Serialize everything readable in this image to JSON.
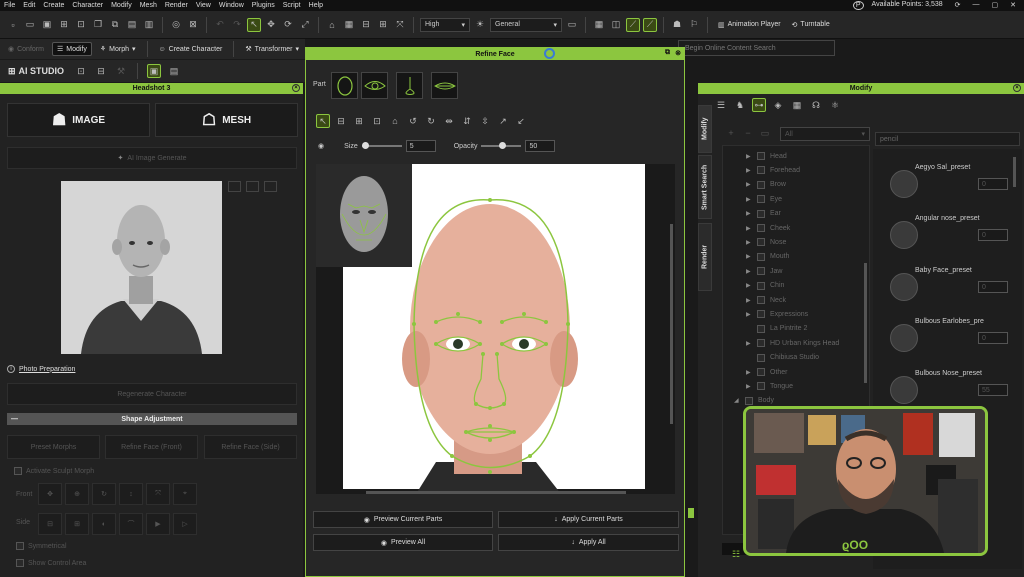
{
  "menu": [
    "File",
    "Edit",
    "Create",
    "Character",
    "Modify",
    "Mesh",
    "Render",
    "View",
    "Window",
    "Plugins",
    "Script",
    "Help"
  ],
  "account": {
    "points": "Available Points: 3,538"
  },
  "toolbar": {
    "quality": "High",
    "mode": "General",
    "animation_player": "Animation Player",
    "turntable": "Turntable"
  },
  "toolbar2": {
    "conform": "Conform",
    "modify": "Modify",
    "morph": "Morph",
    "create_character": "Create Character",
    "transformer": "Transformer"
  },
  "ai_studio": {
    "label": "AI STUDIO"
  },
  "headshot": {
    "title": "Headshot 3",
    "image_btn": "IMAGE",
    "mesh_btn": "MESH",
    "ai_image_gen": "AI Image Generate",
    "photo_prep": "Photo Preparation",
    "regenerate": "Regenerate Character",
    "shape_adjust": "Shape Adjustment",
    "preset_morphs": "Preset Morphs",
    "refine_front": "Refine Face (Front)",
    "refine_side": "Refine Face (Side)",
    "activate_morph": "Activate Sculpt Morph",
    "front": "Front",
    "side": "Side",
    "symmetrical": "Symmetrical",
    "show_control_area": "Show Control Area"
  },
  "refine": {
    "title": "Refine Face",
    "search_placeholder": "Begin Online Content Search",
    "part_label": "Part",
    "size_label": "Size",
    "size_value": "5",
    "opacity_label": "Opacity",
    "opacity_value": "50",
    "preview_current": "Preview Current Parts",
    "apply_current": "Apply Current Parts",
    "preview_all": "Preview All",
    "apply_all": "Apply All"
  },
  "modify": {
    "title": "Modify",
    "tabs": [
      "Modify",
      "Smart Search",
      "Render"
    ],
    "filter": "All",
    "search": "pencil",
    "tree": [
      "Head",
      "Forehead",
      "Brow",
      "Eye",
      "Ear",
      "Cheek",
      "Nose",
      "Mouth",
      "Jaw",
      "Chin",
      "Neck",
      "Expressions",
      "La Pintrite 2",
      "HD Urban Kings Head",
      "Chibiusa Studio",
      "Other",
      "Tongue",
      "Body"
    ],
    "presets": [
      "Aegyo Sal_preset",
      "Angular nose_preset",
      "Baby Face_preset",
      "Bulbous Earlobes_pre",
      "Bulbous Nose_preset"
    ],
    "preset_values": [
      "0",
      "0",
      "0",
      "0",
      "55"
    ]
  },
  "colors": {
    "accent": "#8cc63f"
  }
}
